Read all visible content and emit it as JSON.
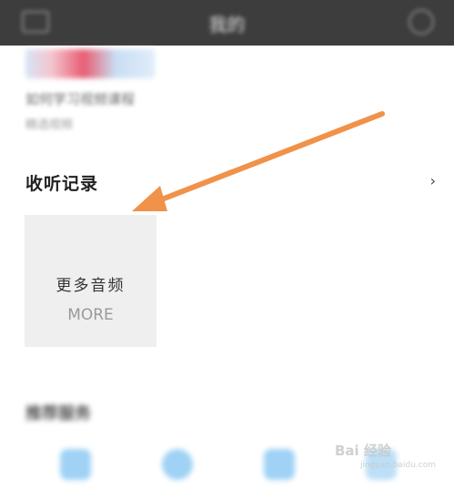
{
  "header": {
    "title": "我的"
  },
  "featured": {
    "title": "如何学习视频课程",
    "subtitle": "精选视频"
  },
  "history": {
    "section_title": "收听记录",
    "more_card": {
      "label": "更多音频",
      "sub_label": "MORE"
    }
  },
  "recommend": {
    "section_title": "推荐服务"
  },
  "watermark": {
    "brand": "Bai 经验",
    "url": "jingyan.baidu.com"
  },
  "colors": {
    "topbar": "#3d3d3d",
    "arrow": "#f0924a",
    "card": "#efefef"
  },
  "icons": [
    "back-icon",
    "settings-icon",
    "chevron-right-icon",
    "arrow-annotation"
  ]
}
